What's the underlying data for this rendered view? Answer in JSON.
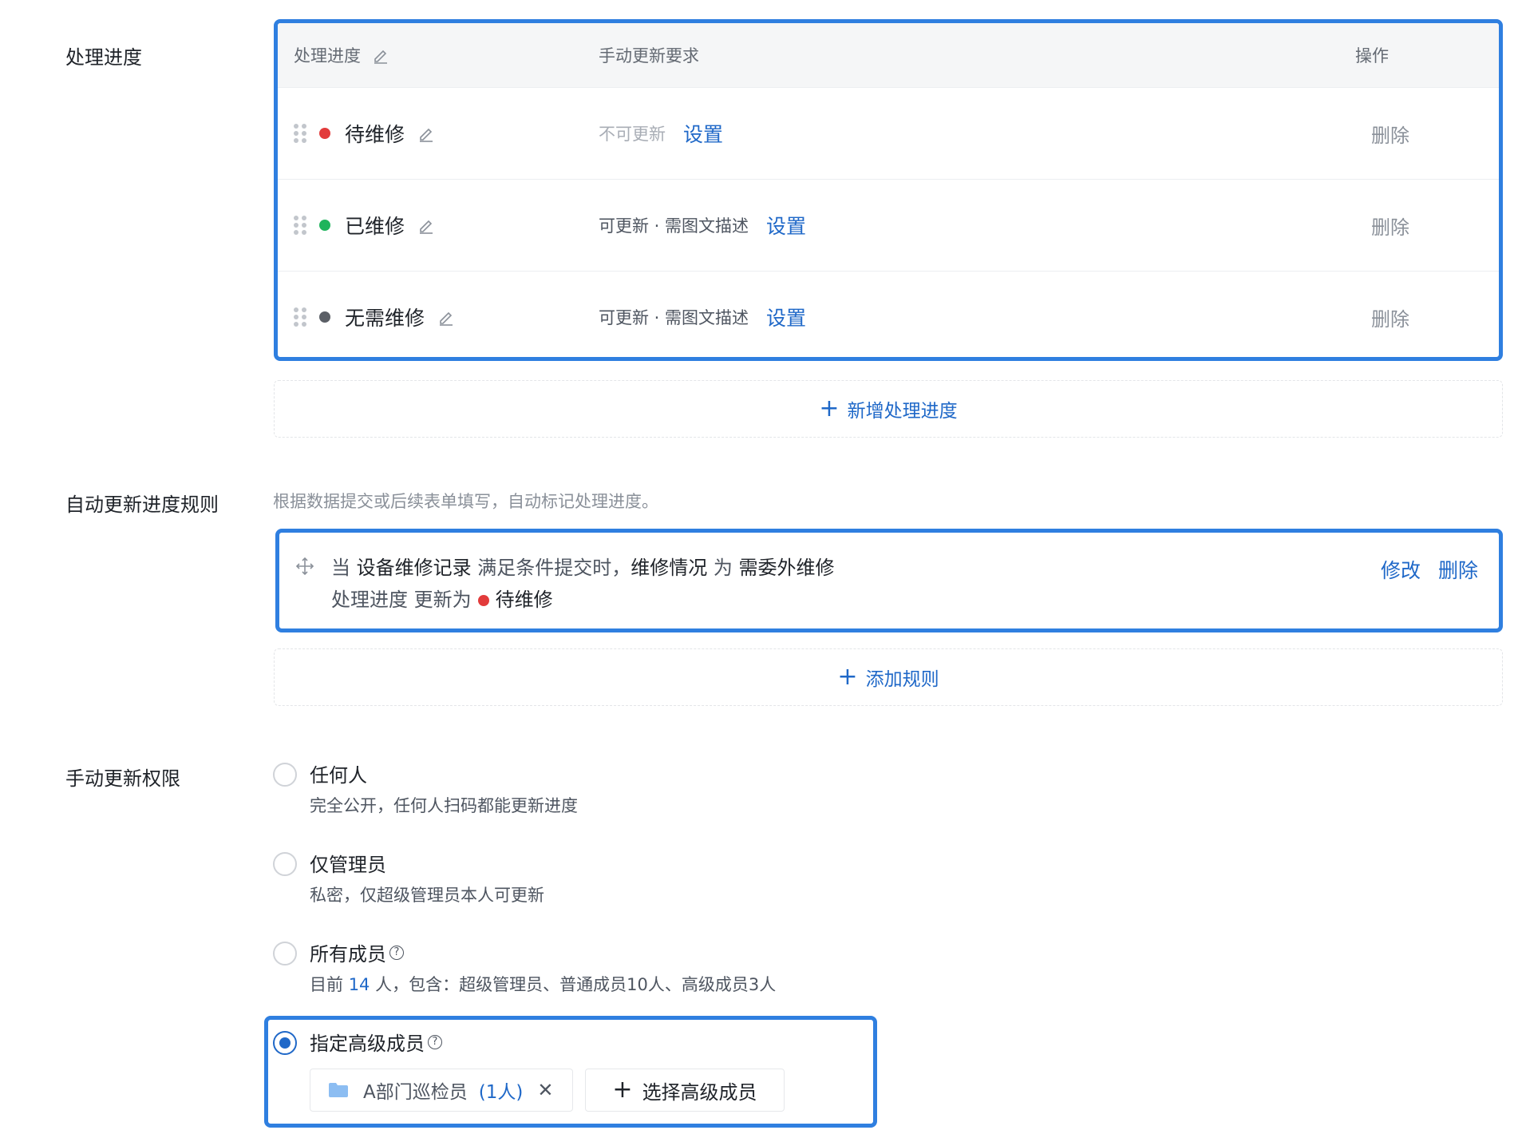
{
  "sections": {
    "progress_label": "处理进度",
    "auto_rule_label": "自动更新进度规则",
    "permission_label": "手动更新权限"
  },
  "progress_table": {
    "headers": {
      "status": "处理进度",
      "requirement": "手动更新要求",
      "action": "操作"
    },
    "rows": [
      {
        "name": "待维修",
        "dot_color": "#e23b3b",
        "requirement": "不可更新",
        "requirement_muted": true,
        "set_label": "设置",
        "delete_label": "删除"
      },
      {
        "name": "已维修",
        "dot_color": "#1fb45c",
        "requirement": "可更新 · 需图文描述",
        "requirement_muted": false,
        "set_label": "设置",
        "delete_label": "删除"
      },
      {
        "name": "无需维修",
        "dot_color": "#5b5f66",
        "requirement": "可更新 · 需图文描述",
        "requirement_muted": false,
        "set_label": "设置",
        "delete_label": "删除"
      }
    ],
    "add_label": "新增处理进度"
  },
  "auto_rule": {
    "hint": "根据数据提交或后续表单填写，自动标记处理进度。",
    "rule": {
      "w_when": "当",
      "form": "设备维修记录",
      "condition_text": "满足条件提交时，",
      "field": "维修情况",
      "w_is": "为",
      "value": "需委外维修",
      "target_field": "处理进度",
      "w_update_to": "更新为",
      "target_status": "待维修",
      "edit_label": "修改",
      "delete_label": "删除"
    },
    "add_label": "添加规则"
  },
  "permissions": {
    "options": [
      {
        "title": "任何人",
        "desc": "完全公开，任何人扫码都能更新进度",
        "checked": false
      },
      {
        "title": "仅管理员",
        "desc": "私密，仅超级管理员本人可更新",
        "checked": false
      },
      {
        "title": "所有成员",
        "desc_prefix": "目前",
        "count": "14",
        "desc_suffix": "人，包含：超级管理员、普通成员10人、高级成员3人",
        "checked": false
      },
      {
        "title": "指定高级成员",
        "checked": true
      }
    ],
    "selected_member": {
      "name": "A部门巡检员",
      "count": "(1人)"
    },
    "choose_label": "选择高级成员"
  },
  "colors": {
    "accent": "#1f68c8",
    "highlight_border": "#2f7fe0"
  }
}
